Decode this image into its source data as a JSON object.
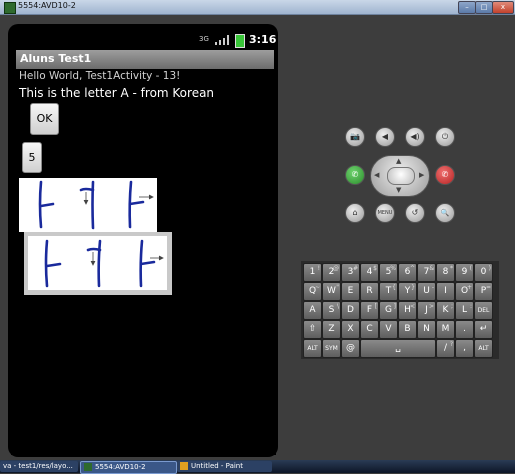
{
  "window": {
    "title": "5554:AVD10-2",
    "controls": [
      "–",
      "□",
      "x"
    ]
  },
  "status": {
    "time": "3:16",
    "network": "3G"
  },
  "app": {
    "title": "Aluns Test1",
    "hello_text": "Hello World, Test1Activity - 13!",
    "letter_text": "This is the letter A - from Korean",
    "ok_label": "OK",
    "count_label": "5"
  },
  "controls": {
    "home_label": "⌂",
    "menu_label": "MENU",
    "back_label": "↺",
    "search_label": "🔍",
    "camera_label": "📷",
    "voldown_label": "◀",
    "volup_label": "◀)",
    "power_label": "⏻",
    "call_label": "✆",
    "endcall_label": "✆"
  },
  "keyboard": {
    "rows": [
      [
        {
          "k": "1",
          "a": "!"
        },
        {
          "k": "2",
          "a": "@"
        },
        {
          "k": "3",
          "a": "#"
        },
        {
          "k": "4",
          "a": "$"
        },
        {
          "k": "5",
          "a": "%"
        },
        {
          "k": "6",
          "a": "^"
        },
        {
          "k": "7",
          "a": "&"
        },
        {
          "k": "8",
          "a": "*"
        },
        {
          "k": "9",
          "a": "("
        },
        {
          "k": "0",
          "a": ")"
        }
      ],
      [
        {
          "k": "Q",
          "a": "~"
        },
        {
          "k": "W",
          "a": "\""
        },
        {
          "k": "E",
          "a": ""
        },
        {
          "k": "R",
          "a": ""
        },
        {
          "k": "T",
          "a": "{"
        },
        {
          "k": "Y",
          "a": "}"
        },
        {
          "k": "U",
          "a": "-"
        },
        {
          "k": "I",
          "a": ""
        },
        {
          "k": "O",
          "a": "+"
        },
        {
          "k": "P",
          "a": "="
        }
      ],
      [
        {
          "k": "A",
          "a": ""
        },
        {
          "k": "S",
          "a": "\\"
        },
        {
          "k": "D",
          "a": ""
        },
        {
          "k": "F",
          "a": "["
        },
        {
          "k": "G",
          "a": "]"
        },
        {
          "k": "H",
          "a": "<"
        },
        {
          "k": "J",
          "a": ">"
        },
        {
          "k": "K",
          "a": ";"
        },
        {
          "k": "L",
          "a": ":"
        },
        {
          "k": "DEL",
          "a": ""
        }
      ],
      [
        {
          "k": "⇧",
          "a": ""
        },
        {
          "k": "Z",
          "a": ""
        },
        {
          "k": "X",
          "a": ""
        },
        {
          "k": "C",
          "a": ""
        },
        {
          "k": "V",
          "a": ""
        },
        {
          "k": "B",
          "a": ""
        },
        {
          "k": "N",
          "a": ""
        },
        {
          "k": "M",
          "a": ""
        },
        {
          "k": ".",
          "a": ""
        },
        {
          "k": "↵",
          "a": ""
        }
      ],
      [
        {
          "k": "ALT",
          "a": ""
        },
        {
          "k": "SYM",
          "a": ""
        },
        {
          "k": "@",
          "a": ""
        },
        {
          "k": "␣",
          "a": ""
        },
        {
          "k": "/",
          "a": "?"
        },
        {
          "k": ",",
          "a": ""
        },
        {
          "k": "ALT",
          "a": ""
        }
      ]
    ]
  },
  "taskbar": {
    "items": [
      "va - test1/res/layo...",
      "5554:AVD10-2",
      "Untitled - Paint"
    ]
  },
  "colors": {
    "screen_bg": "#000000",
    "appbar": "#7a7a7a",
    "emulator_bg": "#3d3d3d",
    "letter_blue": "#1a2a9c"
  }
}
